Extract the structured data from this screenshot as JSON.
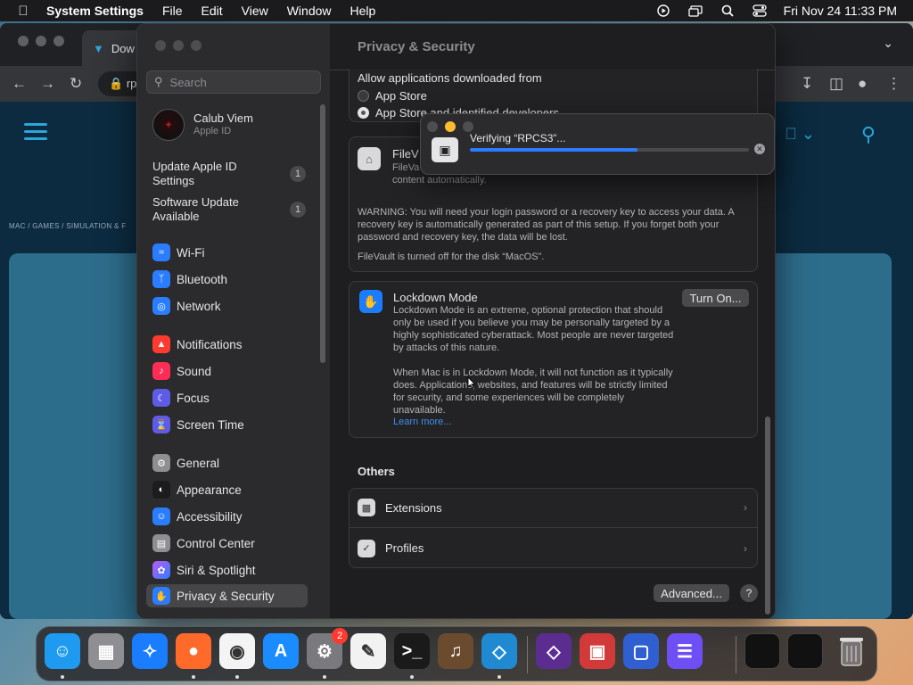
{
  "menubar": {
    "app": "System Settings",
    "items": [
      "File",
      "Edit",
      "View",
      "Window",
      "Help"
    ],
    "datetime": "Fri Nov 24  11:33 PM"
  },
  "browser": {
    "tab_title": "Dow",
    "url": "rp",
    "breadcrumb": "MAC  /  GAMES  /  SIMULATION & F"
  },
  "sidebar": {
    "search_placeholder": "Search",
    "account": {
      "name": "Calub Viem",
      "sub": "Apple ID"
    },
    "notices": [
      {
        "label_1": "Update Apple ID",
        "label_2": "Settings",
        "badge": "1"
      },
      {
        "label_1": "Software Update",
        "label_2": "Available",
        "badge": "1"
      }
    ],
    "items": [
      {
        "label": "Wi-Fi",
        "icon": "wifi-icon",
        "color": "#2a7dff"
      },
      {
        "label": "Bluetooth",
        "icon": "bluetooth-icon",
        "color": "#2a7dff"
      },
      {
        "label": "Network",
        "icon": "globe-icon",
        "color": "#2a7dff"
      },
      {
        "label": "Notifications",
        "icon": "bell-icon",
        "color": "#ff3b30"
      },
      {
        "label": "Sound",
        "icon": "speaker-icon",
        "color": "#ff2d55"
      },
      {
        "label": "Focus",
        "icon": "moon-icon",
        "color": "#5e5ce6"
      },
      {
        "label": "Screen Time",
        "icon": "hourglass-icon",
        "color": "#5e5ce6"
      },
      {
        "label": "General",
        "icon": "gear-icon",
        "color": "#8e8e93"
      },
      {
        "label": "Appearance",
        "icon": "appearance-icon",
        "color": "#1c1c1e"
      },
      {
        "label": "Accessibility",
        "icon": "accessibility-icon",
        "color": "#2a7dff"
      },
      {
        "label": "Control Center",
        "icon": "control-center-icon",
        "color": "#8e8e93"
      },
      {
        "label": "Siri & Spotlight",
        "icon": "siri-icon",
        "color": "#bf5af2"
      },
      {
        "label": "Privacy & Security",
        "icon": "hand-icon",
        "color": "#2a7dff"
      }
    ]
  },
  "content": {
    "title": "Privacy & Security",
    "allow_label": "Allow applications downloaded from",
    "options": [
      "App Store",
      "App Store and identified developers"
    ],
    "filevault": {
      "title": "FileV",
      "line_1": "FileVa",
      "line_2": "content automatically.",
      "warning": "WARNING: You will need your login password or a recovery key to access your data. A recovery key is automatically generated as part of this setup. If you forget both your password and recovery key, the data will be lost.",
      "status": "FileVault is turned off for the disk “MacOS”."
    },
    "lockdown": {
      "title": "Lockdown Mode",
      "desc": "Lockdown Mode is an extreme, optional protection that should only be used if you believe you may be personally targeted by a highly sophisticated cyberattack. Most people are never targeted by attacks of this nature.",
      "desc2": "When Mac is in Lockdown Mode, it will not function as it typically does. Applications, websites, and features will be strictly limited for security, and some experiences will be completely unavailable.",
      "learn_more": "Learn more...",
      "button": "Turn On..."
    },
    "others_title": "Others",
    "others": [
      {
        "label": "Extensions",
        "icon": "extensions-icon"
      },
      {
        "label": "Profiles",
        "icon": "profiles-icon"
      }
    ],
    "advanced_button": "Advanced...",
    "help_button": "?"
  },
  "verify_dialog": {
    "message": "Verifying “RPCS3”...",
    "progress": 0.6
  },
  "dock": {
    "apps": [
      {
        "name": "Finder",
        "icon": "finder-icon",
        "color": "#1e9bf0",
        "glyph": "☺",
        "running": true
      },
      {
        "name": "Launchpad",
        "icon": "launchpad-icon",
        "color": "#8e8e93",
        "glyph": "▦",
        "running": false
      },
      {
        "name": "Safari",
        "icon": "safari-icon",
        "color": "#1a7cff",
        "glyph": "✧",
        "running": false
      },
      {
        "name": "Firefox",
        "icon": "firefox-icon",
        "color": "#ff6a2a",
        "glyph": "●",
        "running": true
      },
      {
        "name": "Chrome",
        "icon": "chrome-icon",
        "color": "#f4f4f4",
        "glyph": "◉",
        "running": true
      },
      {
        "name": "App Store",
        "icon": "app-store-icon",
        "color": "#1a8cff",
        "glyph": "A",
        "running": false
      },
      {
        "name": "System Settings",
        "icon": "system-settings-icon",
        "color": "#7a7a7e",
        "glyph": "⚙",
        "running": true,
        "badge": "2"
      },
      {
        "name": "TextEdit",
        "icon": "textedit-icon",
        "color": "#f2f2f2",
        "glyph": "✎",
        "running": false
      },
      {
        "name": "Terminal",
        "icon": "terminal-icon",
        "color": "#1a1a1a",
        "glyph": ">_",
        "running": true
      },
      {
        "name": "GarageBand",
        "icon": "garageband-icon",
        "color": "#6b4b2e",
        "glyph": "♫",
        "running": false
      },
      {
        "name": "Visual Studio Code",
        "icon": "vscode-icon",
        "color": "#1f8ad2",
        "glyph": "◇",
        "running": true
      },
      {
        "name": "Visual Studio",
        "icon": "visual-studio-icon",
        "color": "#5c2d91",
        "glyph": "◇",
        "running": false
      },
      {
        "name": "Photo Booth",
        "icon": "photo-booth-icon",
        "color": "#d23a3a",
        "glyph": "▣",
        "running": false
      },
      {
        "name": "Screens",
        "icon": "screens-icon",
        "color": "#2f5fd1",
        "glyph": "▢",
        "running": false
      },
      {
        "name": "Installer",
        "icon": "installer-icon",
        "color": "#6e4ef5",
        "glyph": "☰",
        "running": false
      }
    ],
    "trash_icon": "trash-icon"
  }
}
